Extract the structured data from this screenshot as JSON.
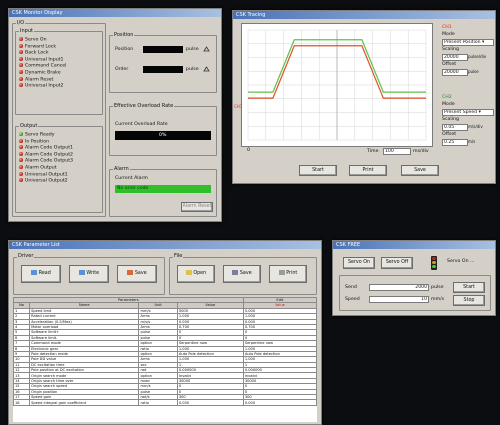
{
  "monitor": {
    "title": "CSK Monitor Display",
    "io_group": "I/O",
    "input_group": "Input",
    "inputs": [
      "Servo On",
      "Forward Lock",
      "Back Lock",
      "Universal Input1",
      "Command Cancel",
      "Dynamic Brake",
      "Alarm Reset",
      "Universal Input2"
    ],
    "output_group": "Output",
    "outputs": [
      "Servo Ready",
      "In Position",
      "Alarm Code Output1",
      "Alarm Code Output2",
      "Alarm Code Output3",
      "Alarm Output",
      "Universal Output1",
      "Universal Output2"
    ],
    "position_group": "Position",
    "position_label": "Position",
    "order_label": "Order",
    "unit_pulse": "pulse",
    "overload_group": "Effective Overload Rate",
    "current_overload_label": "Current Overload Rate",
    "overload_value": "0%",
    "alarm_group": "Alarm",
    "current_alarm_label": "Current Alarm",
    "current_alarm_value": "No error code",
    "alarm_reset_button": "Alarm Reset"
  },
  "trace": {
    "title": "CSK Tracing",
    "ch1": "CH1",
    "ch2": "CH2",
    "mode_label": "Mode",
    "mode1_value": "Present Position",
    "scaling_label": "Scaling",
    "scaling1_value": "20000",
    "offset_label": "Offset",
    "offset1_value": "20000",
    "mode2_value": "Present Speed",
    "scaling2_value": "0.05",
    "offset2_value": "0.25",
    "unit_pulse_div": "pulse/div",
    "unit_pulse": "pulse",
    "unit_ms_div": "m/s/div",
    "unit_ms": "m/s",
    "axis_zero": "0",
    "time_label": "Time",
    "time_value": "100",
    "time_unit": "ms/div",
    "start_button": "Start",
    "print_button": "Print",
    "save_button": "Save",
    "chart_data": {
      "type": "line",
      "x": [
        0,
        1.4,
        2.6,
        6.4,
        7.6,
        10
      ],
      "series": [
        {
          "values": [
            0,
            0,
            1,
            1,
            0,
            0
          ]
        },
        {
          "values": [
            0,
            0,
            1,
            1,
            0,
            0
          ]
        }
      ],
      "ylim": [
        -0.8,
        1.3
      ],
      "xlim": [
        0,
        10
      ],
      "grid": true
    }
  },
  "params": {
    "title": "CSK Parameter List",
    "driver_group": "Driver",
    "file_group": "File",
    "read_button": "Read",
    "write_button": "Write",
    "driver_save_button": "Save",
    "open_button": "Open",
    "file_save_button": "Save",
    "print_button": "Print",
    "header_parameters": "Parameters",
    "header_edit": "Edit",
    "columns": [
      "No",
      "Name",
      "Unit",
      "Value",
      "Value"
    ],
    "rows": [
      [
        "1",
        "Speed limit",
        "mm/s",
        "5000",
        "5.000"
      ],
      [
        "2",
        "Rated current",
        "Arms",
        "1.000",
        "1.000"
      ],
      [
        "3",
        "Acceleration (0.5/Max)",
        "m/s/s",
        "0.000",
        "0.000"
      ],
      [
        "4",
        "Motor overload",
        "Arms",
        "0.700",
        "0.700"
      ],
      [
        "5",
        "Software limit+",
        "pulse",
        "0",
        "0"
      ],
      [
        "6",
        "Software limit-",
        "pulse",
        "0",
        "0"
      ],
      [
        "7",
        "Command mode",
        "option",
        "Serpentine now",
        "Serpentine now"
      ],
      [
        "8",
        "Electronic gear",
        "ratio",
        "1.000",
        "1.000"
      ],
      [
        "9",
        "Pole detection mode",
        "option",
        "Auto Pole detection",
        "Auto Pole detection"
      ],
      [
        "10",
        "Pole DD value",
        "Arms",
        "1.000",
        "1.000"
      ],
      [
        "11",
        "DC excitation time",
        "sec",
        "1",
        "1"
      ],
      [
        "12",
        "Pole position at DC excitation",
        "rad",
        "0.000000",
        "0.000000"
      ],
      [
        "13",
        "Origin search mode",
        "option",
        "Invalid",
        "Invalid"
      ],
      [
        "14",
        "Origin search time over",
        "msec",
        "30000",
        "30000"
      ],
      [
        "15",
        "Origin search speed",
        "mm/s",
        "0",
        "0"
      ],
      [
        "16",
        "Origin position",
        "pulse",
        "0",
        "0"
      ],
      [
        "17",
        "Speed gain",
        "rad/s",
        "300",
        "300"
      ],
      [
        "18",
        "Speed integral gain coefficient",
        "ratio",
        "0.000",
        "0.000"
      ]
    ]
  },
  "csk_status": {
    "title": "CSK FREE",
    "servo_on_button": "Servo On",
    "servo_off_button": "Servo Off",
    "servo_status_label": "Servo On ...",
    "send_label": "Send",
    "send_value": "2000",
    "send_unit": "pulse",
    "speed_label": "Speed",
    "speed_value": "10",
    "speed_unit": "mm/s",
    "start_button": "Start",
    "stop_button": "Stop"
  }
}
